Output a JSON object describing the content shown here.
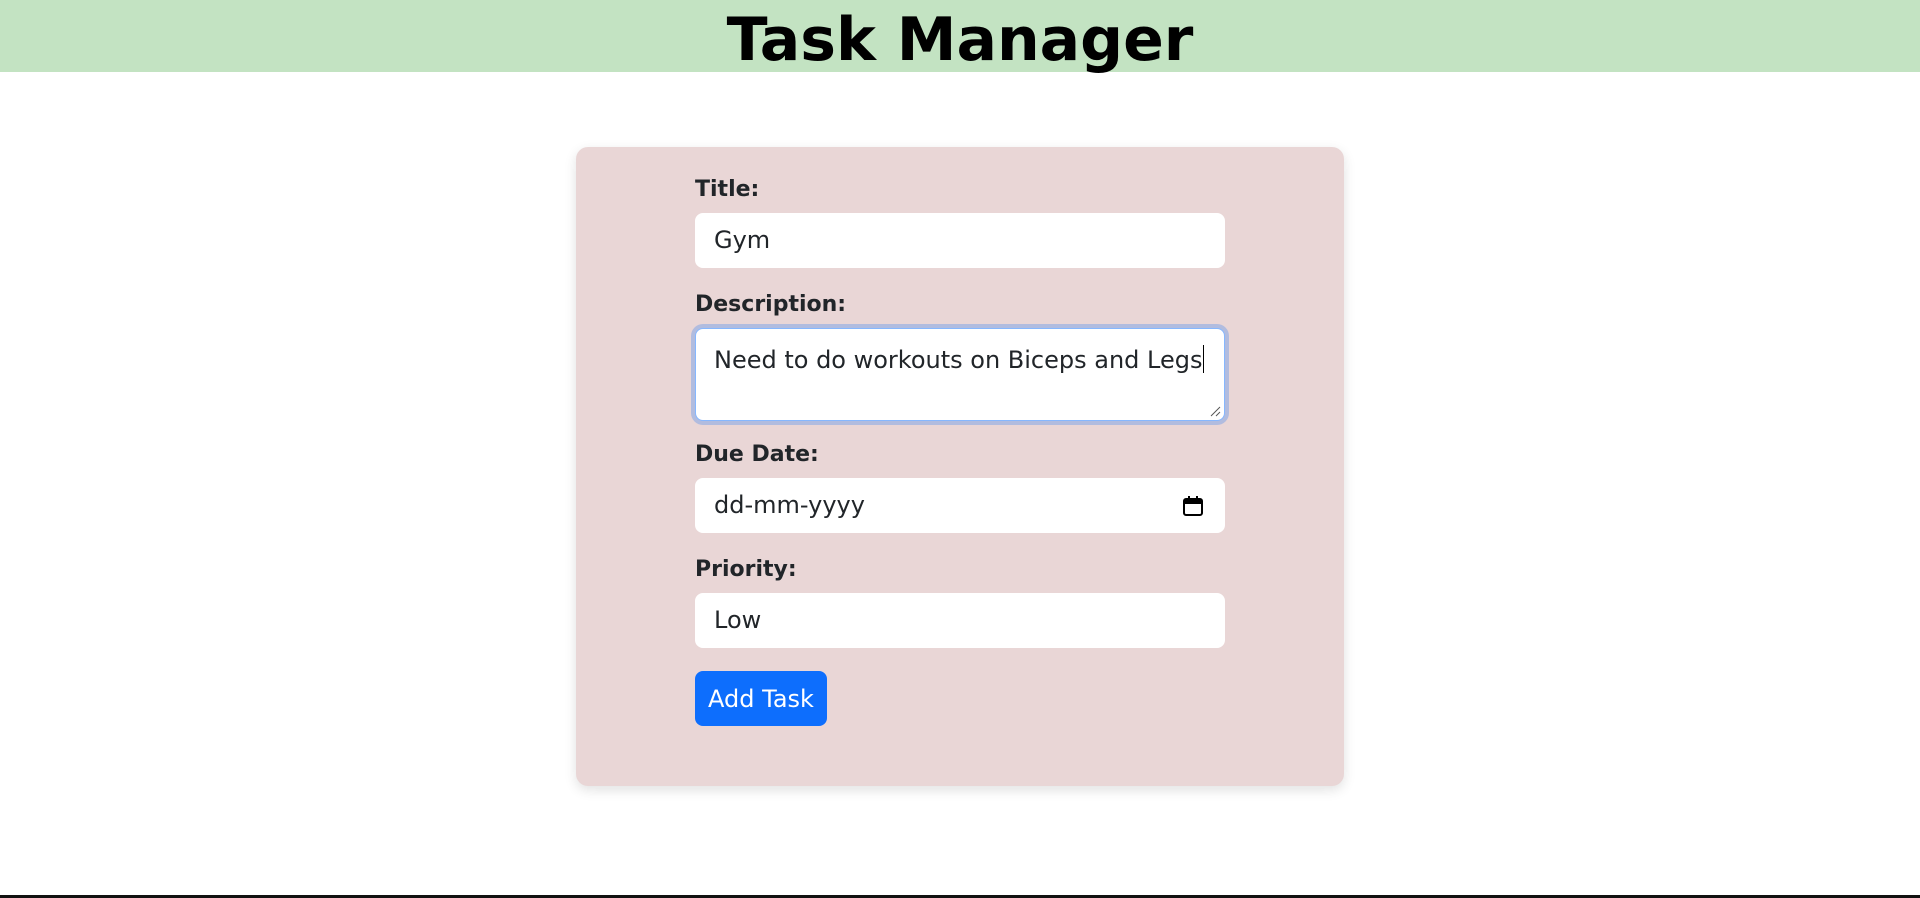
{
  "header": {
    "title": "Task Manager"
  },
  "form": {
    "title_label": "Title:",
    "title_value": "Gym",
    "description_label": "Description:",
    "description_value": "Need to do workouts on Biceps and Legs",
    "due_date_label": "Due Date:",
    "due_date_placeholder": "dd-mm-yyyy",
    "priority_label": "Priority:",
    "priority_value": "Low",
    "submit_label": "Add Task"
  },
  "colors": {
    "header_bg": "#c3e3c2",
    "card_bg": "#e9d6d6",
    "primary": "#0d6efd"
  },
  "icons": {
    "due_date": "calendar-icon"
  }
}
